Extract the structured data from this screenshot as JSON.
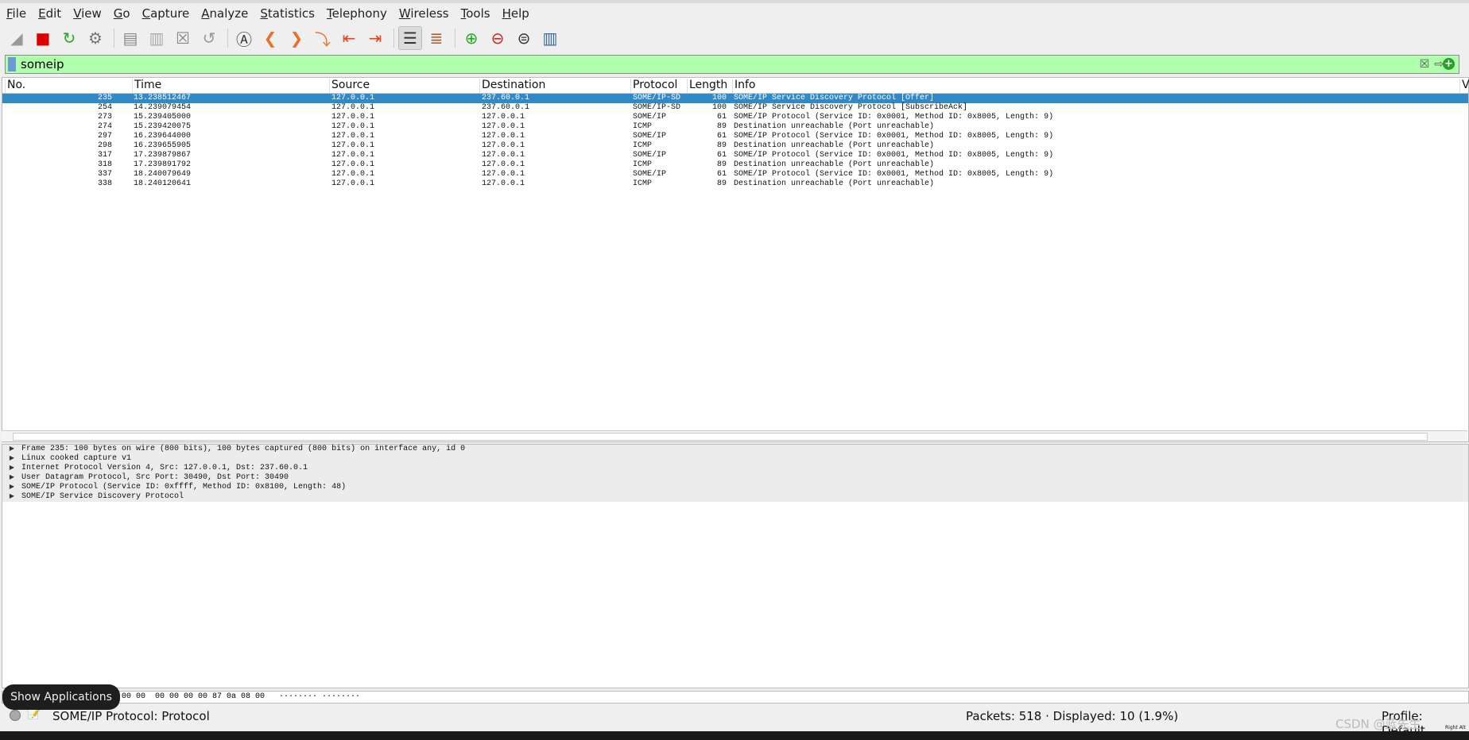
{
  "menu": [
    "File",
    "Edit",
    "View",
    "Go",
    "Capture",
    "Analyze",
    "Statistics",
    "Telephony",
    "Wireless",
    "Tools",
    "Help"
  ],
  "toolbar": [
    "shark-fin-start-icon",
    "stop-capture-icon",
    "restart-capture-icon",
    "capture-options-icon",
    "open-file-icon",
    "save-file-icon",
    "close-file-icon",
    "reload-file-icon",
    "find-packet-icon",
    "go-back-icon",
    "go-forward-icon",
    "go-to-packet-icon",
    "first-packet-icon",
    "last-packet-icon",
    "autoscroll-icon",
    "colorize-icon",
    "zoom-in-icon",
    "zoom-out-icon",
    "normal-size-icon",
    "resize-columns-icon"
  ],
  "filter": {
    "value": "someip"
  },
  "columns": [
    "No.",
    "Time",
    "Source",
    "Destination",
    "Protocol",
    "Length",
    "Info",
    "Vi"
  ],
  "packets": [
    {
      "no": "235",
      "time": "13.238512467",
      "src": "127.0.0.1",
      "dst": "237.60.0.1",
      "proto": "SOME/IP-SD",
      "len": "100",
      "info": "SOME/IP Service Discovery Protocol [Offer]"
    },
    {
      "no": "254",
      "time": "14.239079454",
      "src": "127.0.0.1",
      "dst": "237.60.0.1",
      "proto": "SOME/IP-SD",
      "len": "100",
      "info": "SOME/IP Service Discovery Protocol [SubscribeAck]"
    },
    {
      "no": "273",
      "time": "15.239405000",
      "src": "127.0.0.1",
      "dst": "127.0.0.1",
      "proto": "SOME/IP",
      "len": "61",
      "info": "SOME/IP Protocol (Service ID: 0x0001, Method ID: 0x8005, Length: 9)"
    },
    {
      "no": "274",
      "time": "15.239420075",
      "src": "127.0.0.1",
      "dst": "127.0.0.1",
      "proto": "ICMP",
      "len": "89",
      "info": "Destination unreachable (Port unreachable)"
    },
    {
      "no": "297",
      "time": "16.239644000",
      "src": "127.0.0.1",
      "dst": "127.0.0.1",
      "proto": "SOME/IP",
      "len": "61",
      "info": "SOME/IP Protocol (Service ID: 0x0001, Method ID: 0x8005, Length: 9)"
    },
    {
      "no": "298",
      "time": "16.239655905",
      "src": "127.0.0.1",
      "dst": "127.0.0.1",
      "proto": "ICMP",
      "len": "89",
      "info": "Destination unreachable (Port unreachable)"
    },
    {
      "no": "317",
      "time": "17.239879867",
      "src": "127.0.0.1",
      "dst": "127.0.0.1",
      "proto": "SOME/IP",
      "len": "61",
      "info": "SOME/IP Protocol (Service ID: 0x0001, Method ID: 0x8005, Length: 9)"
    },
    {
      "no": "318",
      "time": "17.239891792",
      "src": "127.0.0.1",
      "dst": "127.0.0.1",
      "proto": "ICMP",
      "len": "89",
      "info": "Destination unreachable (Port unreachable)"
    },
    {
      "no": "337",
      "time": "18.240079649",
      "src": "127.0.0.1",
      "dst": "127.0.0.1",
      "proto": "SOME/IP",
      "len": "61",
      "info": "SOME/IP Protocol (Service ID: 0x0001, Method ID: 0x8005, Length: 9)"
    },
    {
      "no": "338",
      "time": "18.240120641",
      "src": "127.0.0.1",
      "dst": "127.0.0.1",
      "proto": "ICMP",
      "len": "89",
      "info": "Destination unreachable (Port unreachable)"
    }
  ],
  "details": [
    "Frame 235: 100 bytes on wire (800 bits), 100 bytes captured (800 bits) on interface any, id 0",
    "Linux cooked capture v1",
    "Internet Protocol Version 4, Src: 127.0.0.1, Dst: 237.60.0.1",
    "User Datagram Protocol, Src Port: 30490, Dst Port: 30490",
    "SOME/IP Protocol (Service ID: 0xffff, Method ID: 0x8100, Length: 48)",
    "SOME/IP Service Discovery Protocol"
  ],
  "hex": "00 00  00 00 00 00 87 0a 08 00   ········ ········",
  "status": {
    "field": "SOME/IP Protocol: Protocol",
    "packets": "Packets: 518 · Displayed: 10 (1.9%)",
    "profile": "Profile: Default"
  },
  "dock": {
    "show_apps": "Show Applications"
  },
  "watermark": "CSDN @蓝先生",
  "keyboard_hint": "Right Alt",
  "colors": {
    "selected": "#3289c7",
    "filter_valid": "#afffaf"
  }
}
